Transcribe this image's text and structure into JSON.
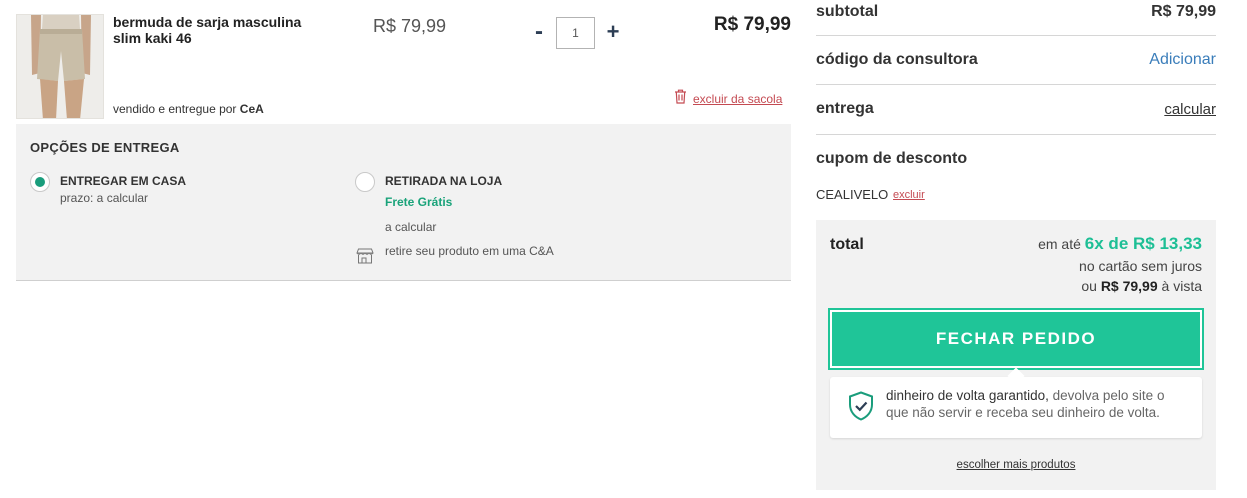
{
  "product": {
    "name": "bermuda de sarja masculina slim kaki 46",
    "seller_prefix": "vendido e entregue por",
    "seller_name": "CeA",
    "unit_price": "R$ 79,99",
    "quantity": "1",
    "qty_minus": "-",
    "qty_plus": "+",
    "total_price": "R$ 79,99",
    "remove_label": "excluir da sacola"
  },
  "delivery": {
    "title": "OPÇÕES DE ENTREGA",
    "home": {
      "label": "ENTREGAR EM CASA",
      "detail": "prazo: a calcular",
      "selected": true
    },
    "pickup": {
      "label": "RETIRADA NA LOJA",
      "free": "Frete Grátis",
      "detail": "a calcular",
      "store_note": "retire seu produto em uma C&A",
      "selected": false
    }
  },
  "summary": {
    "subtotal_label": "subtotal",
    "subtotal_value": "R$ 79,99",
    "consultant_label": "código da consultora",
    "consultant_action": "Adicionar",
    "shipping_label": "entrega",
    "shipping_action": "calcular",
    "coupon_label": "cupom de desconto",
    "coupon_code": "CEALIVELO",
    "coupon_remove": "excluir",
    "total_label": "total",
    "installments_prefix": "em até",
    "installments_highlight": "6x de R$ 13,33",
    "installments_note": "no cartão sem juros",
    "cash_prefix": "ou",
    "cash_value": "R$ 79,99",
    "cash_suffix": "à vista",
    "checkout_label": "FECHAR PEDIDO",
    "guarantee_emphasis": "dinheiro de volta garantido,",
    "guarantee_rest": " devolva pelo site o que não servir e receba seu dinheiro de volta.",
    "more_products": "escolher mais produtos"
  },
  "colors": {
    "accent_green": "#1fc598",
    "radio_green": "#1a9d7c",
    "link_blue": "#3a7dba",
    "danger_red": "#c44a52",
    "panel_gray": "#f2f2f2"
  }
}
